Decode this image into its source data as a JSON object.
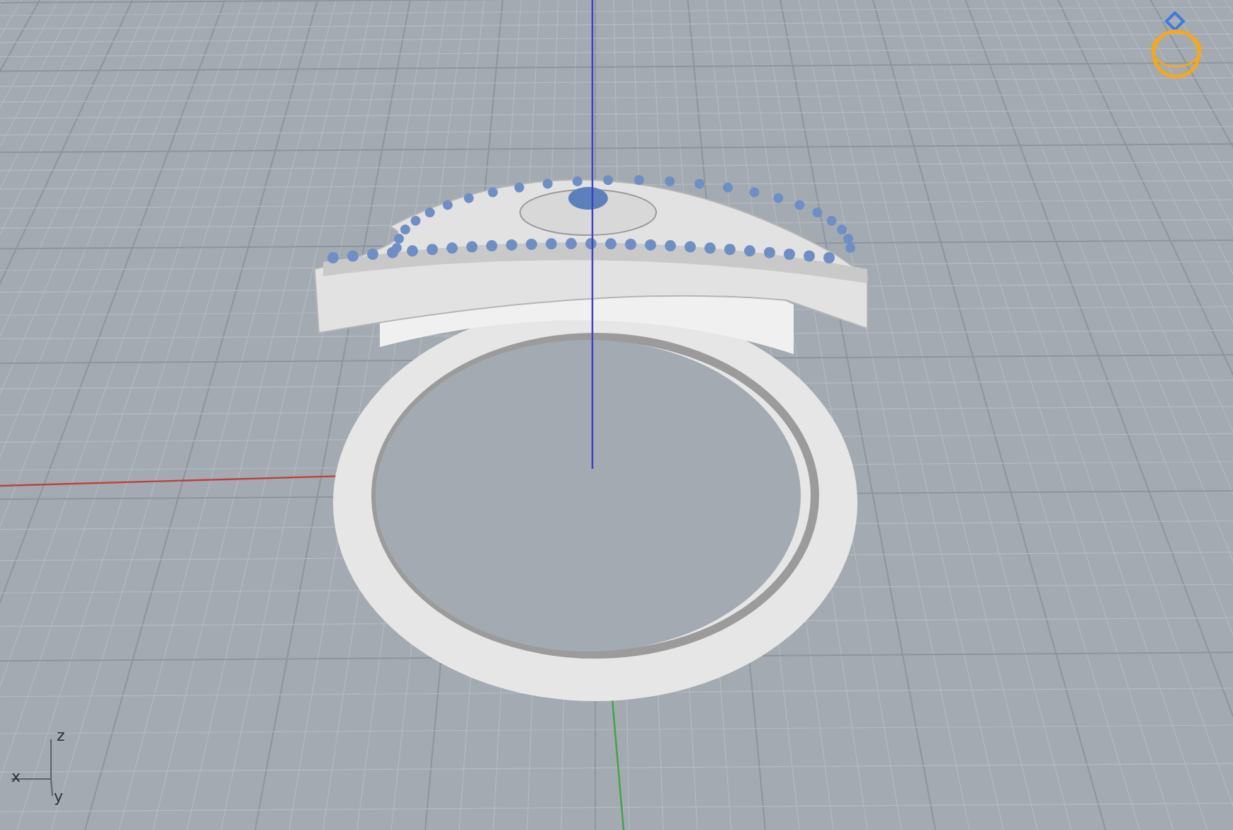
{
  "viewport": {
    "axis_gizmo": {
      "labels": [
        "z",
        "x",
        "y"
      ]
    }
  }
}
